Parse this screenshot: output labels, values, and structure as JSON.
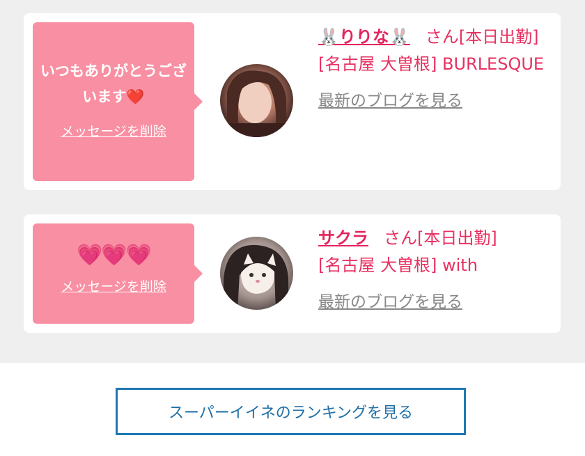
{
  "messages": [
    {
      "message": "いつもありがとうございます❤️",
      "delete_label": "メッセージを削除",
      "name": "🐰りりな🐰",
      "suffix": "さん[本日出勤]",
      "shop": "[名古屋 大曽根] BURLESQUE",
      "blog_label": "最新のブログを見る"
    },
    {
      "message": "💗💗💗",
      "delete_label": "メッセージを削除",
      "name": "サクラ",
      "suffix": "さん[本日出勤]",
      "shop": "[名古屋 大曽根] with",
      "blog_label": "最新のブログを見る"
    }
  ],
  "ranking_button_label": "スーパーイイネのランキングを見る",
  "colors": {
    "bubble": "#f98fa2",
    "accent": "#e4245c",
    "button_border": "#1f78b4"
  }
}
